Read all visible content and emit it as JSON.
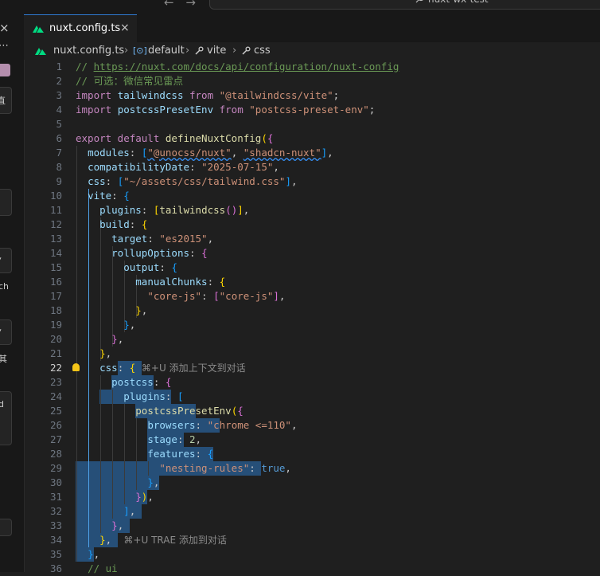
{
  "titlebar": {
    "back": "←",
    "forward": "→",
    "search_text": "nuxt-wx-test"
  },
  "sidebar": {
    "close": "×",
    "more": "⋯",
    "frag1": "直",
    "frag2": "ch",
    "frag3": "其",
    "frag4": "d"
  },
  "tab": {
    "name": "nuxt.config.ts",
    "close": "×"
  },
  "breadcrumb": {
    "file": "nuxt.config.ts",
    "sep": "›",
    "item1": "default",
    "item2": "vite",
    "item3": "css"
  },
  "hints": {
    "line22": "⌘+U 添加上下文到对话",
    "line34": "⌘+U TRAE 添加到对话"
  },
  "editor": {
    "current_line": 22
  },
  "colors": {
    "accent": "#2f7ad1",
    "selection": "#264f78",
    "nuxt_green": "#00dc82"
  },
  "lines": [
    [
      [
        "cmt",
        "// "
      ],
      [
        "lnk",
        "https://nuxt.com/docs/api/configuration/nuxt-config"
      ]
    ],
    [
      [
        "cmt",
        "// 可选：微信常见雷点"
      ]
    ],
    [
      [
        "kw",
        "import "
      ],
      [
        "var",
        "tailwindcss "
      ],
      [
        "kw",
        "from "
      ],
      [
        "str",
        "\"@tailwindcss/vite\""
      ],
      [
        "plain",
        ";"
      ]
    ],
    [
      [
        "kw",
        "import "
      ],
      [
        "var",
        "postcssPresetEnv "
      ],
      [
        "kw",
        "from "
      ],
      [
        "str",
        "\"postcss-preset-env\""
      ],
      [
        "plain",
        ";"
      ]
    ],
    [],
    [
      [
        "kw",
        "export default "
      ],
      [
        "fn",
        "defineNuxtConfig"
      ],
      [
        "b1",
        "("
      ],
      [
        "b2",
        "{"
      ]
    ],
    [
      [
        "plain",
        "  "
      ],
      [
        "var",
        "modules"
      ],
      [
        "plain",
        ": "
      ],
      [
        "b3",
        "["
      ],
      [
        "str",
        "\"@unocss/nuxt\""
      ],
      [
        "plain",
        ", "
      ],
      [
        "str",
        "\"shadcn-nuxt\""
      ],
      [
        "b3",
        "]"
      ],
      [
        "plain",
        ","
      ]
    ],
    [
      [
        "plain",
        "  "
      ],
      [
        "var",
        "compatibilityDate"
      ],
      [
        "plain",
        ": "
      ],
      [
        "str",
        "\"2025-07-15\""
      ],
      [
        "plain",
        ","
      ]
    ],
    [
      [
        "plain",
        "  "
      ],
      [
        "var",
        "css"
      ],
      [
        "plain",
        ": "
      ],
      [
        "b3",
        "["
      ],
      [
        "str",
        "\"~/assets/css/tailwind.css\""
      ],
      [
        "b3",
        "]"
      ],
      [
        "plain",
        ","
      ]
    ],
    [
      [
        "plain",
        "  "
      ],
      [
        "var",
        "vite"
      ],
      [
        "plain",
        ": "
      ],
      [
        "b3",
        "{"
      ]
    ],
    [
      [
        "plain",
        "    "
      ],
      [
        "var",
        "plugins"
      ],
      [
        "plain",
        ": "
      ],
      [
        "b1",
        "["
      ],
      [
        "fn",
        "tailwindcss"
      ],
      [
        "b2",
        "()"
      ],
      [
        "b1",
        "]"
      ],
      [
        "plain",
        ","
      ]
    ],
    [
      [
        "plain",
        "    "
      ],
      [
        "var",
        "build"
      ],
      [
        "plain",
        ": "
      ],
      [
        "b1",
        "{"
      ]
    ],
    [
      [
        "plain",
        "      "
      ],
      [
        "var",
        "target"
      ],
      [
        "plain",
        ": "
      ],
      [
        "str",
        "\"es2015\""
      ],
      [
        "plain",
        ","
      ]
    ],
    [
      [
        "plain",
        "      "
      ],
      [
        "var",
        "rollupOptions"
      ],
      [
        "plain",
        ": "
      ],
      [
        "b2",
        "{"
      ]
    ],
    [
      [
        "plain",
        "        "
      ],
      [
        "var",
        "output"
      ],
      [
        "plain",
        ": "
      ],
      [
        "b3",
        "{"
      ]
    ],
    [
      [
        "plain",
        "          "
      ],
      [
        "var",
        "manualChunks"
      ],
      [
        "plain",
        ": "
      ],
      [
        "b1",
        "{"
      ]
    ],
    [
      [
        "plain",
        "            "
      ],
      [
        "str",
        "\"core-js\""
      ],
      [
        "plain",
        ": "
      ],
      [
        "b2",
        "["
      ],
      [
        "str",
        "\"core-js\""
      ],
      [
        "b2",
        "]"
      ],
      [
        "plain",
        ","
      ]
    ],
    [
      [
        "plain",
        "          "
      ],
      [
        "b1",
        "}"
      ],
      [
        "plain",
        ","
      ]
    ],
    [
      [
        "plain",
        "        "
      ],
      [
        "b3",
        "}"
      ],
      [
        "plain",
        ","
      ]
    ],
    [
      [
        "plain",
        "      "
      ],
      [
        "b2",
        "}"
      ],
      [
        "plain",
        ","
      ]
    ],
    [
      [
        "plain",
        "    "
      ],
      [
        "b1",
        "}"
      ],
      [
        "plain",
        ","
      ]
    ],
    [
      [
        "plain",
        "    "
      ],
      [
        "var",
        "css"
      ],
      [
        "plain",
        ": "
      ],
      [
        "b1",
        "{"
      ]
    ],
    [
      [
        "plain",
        "      "
      ],
      [
        "var",
        "postcss"
      ],
      [
        "plain",
        ": "
      ],
      [
        "b2",
        "{"
      ]
    ],
    [
      [
        "plain",
        "        "
      ],
      [
        "var",
        "plugins"
      ],
      [
        "plain",
        ": "
      ],
      [
        "b3",
        "["
      ]
    ],
    [
      [
        "plain",
        "          "
      ],
      [
        "fn",
        "postcssPresetEnv"
      ],
      [
        "b1",
        "("
      ],
      [
        "b2",
        "{"
      ]
    ],
    [
      [
        "plain",
        "            "
      ],
      [
        "var",
        "browsers"
      ],
      [
        "plain",
        ": "
      ],
      [
        "str",
        "\"chrome <=110\""
      ],
      [
        "plain",
        ","
      ]
    ],
    [
      [
        "plain",
        "            "
      ],
      [
        "var",
        "stage"
      ],
      [
        "plain",
        ": "
      ],
      [
        "num",
        "2"
      ],
      [
        "plain",
        ","
      ]
    ],
    [
      [
        "plain",
        "            "
      ],
      [
        "var",
        "features"
      ],
      [
        "plain",
        ": "
      ],
      [
        "b3",
        "{"
      ]
    ],
    [
      [
        "plain",
        "              "
      ],
      [
        "str",
        "\"nesting-rules\""
      ],
      [
        "plain",
        ": "
      ],
      [
        "bool",
        "true"
      ],
      [
        "plain",
        ","
      ]
    ],
    [
      [
        "plain",
        "            "
      ],
      [
        "b3",
        "}"
      ],
      [
        "plain",
        ","
      ]
    ],
    [
      [
        "plain",
        "          "
      ],
      [
        "b2",
        "}"
      ],
      [
        "b1",
        ")"
      ],
      [
        "plain",
        ","
      ]
    ],
    [
      [
        "plain",
        "        "
      ],
      [
        "b3",
        "]"
      ],
      [
        "plain",
        ","
      ]
    ],
    [
      [
        "plain",
        "      "
      ],
      [
        "b2",
        "}"
      ],
      [
        "plain",
        ","
      ]
    ],
    [
      [
        "plain",
        "    "
      ],
      [
        "b1",
        "}"
      ],
      [
        "plain",
        ","
      ]
    ],
    [
      [
        "plain",
        "  "
      ],
      [
        "b3",
        "}"
      ],
      [
        "plain",
        ","
      ]
    ],
    [
      [
        "plain",
        "  "
      ],
      [
        "cmt",
        "// ui"
      ]
    ]
  ]
}
